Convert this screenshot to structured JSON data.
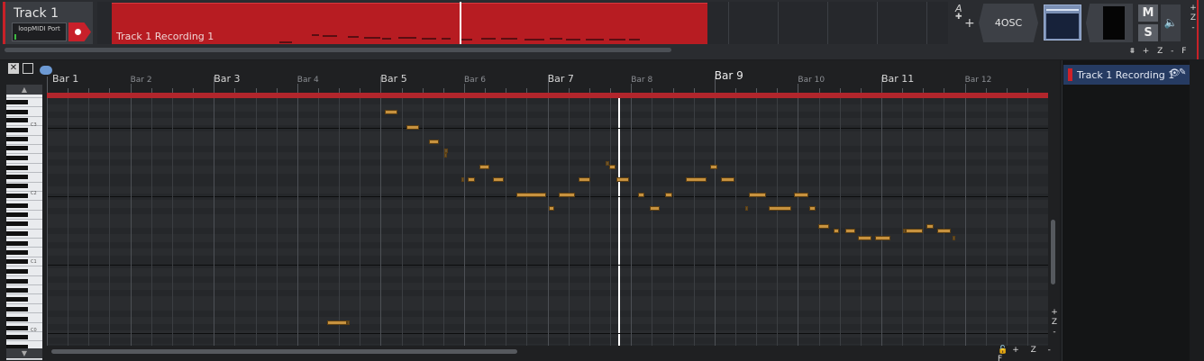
{
  "track": {
    "name": "Track 1",
    "midi_input": "loopMIDI Port",
    "clip_name": "Track 1 Recording 1",
    "plugin": "4OSC",
    "mute_label": "M",
    "solo_label": "S",
    "automation_label": "A",
    "add_label": "+"
  },
  "track_zoom": {
    "plus": "+",
    "z": "Z",
    "minus": "-",
    "fit": "F"
  },
  "bottom_tools": "+ Z - F",
  "piano_roll": {
    "bars": [
      {
        "label": "Bar 1",
        "style": "normal"
      },
      {
        "label": "Bar 2",
        "style": "minor"
      },
      {
        "label": "Bar 3",
        "style": "normal"
      },
      {
        "label": "Bar 4",
        "style": "minor"
      },
      {
        "label": "Bar 5",
        "style": "normal"
      },
      {
        "label": "Bar 6",
        "style": "minor"
      },
      {
        "label": "Bar 7",
        "style": "normal"
      },
      {
        "label": "Bar 8",
        "style": "minor"
      },
      {
        "label": "Bar 9",
        "style": "major"
      },
      {
        "label": "Bar 10",
        "style": "minor"
      },
      {
        "label": "Bar 11",
        "style": "normal"
      },
      {
        "label": "Bar 12",
        "style": "minor"
      }
    ],
    "octave_labels": [
      "C3",
      "C2",
      "C1",
      "C0"
    ],
    "playhead_bar": 7.85,
    "zoom_v": {
      "plus": "+",
      "z": "Z",
      "minus": "-"
    },
    "zoom_h": "+ Z - F",
    "colors": {
      "note": "#c7923f",
      "region": "#b2262c",
      "clip": "#b71c22"
    }
  },
  "track_list": {
    "items": [
      {
        "label": "Track 1 Recording 1",
        "color": "#cf2128"
      }
    ]
  }
}
